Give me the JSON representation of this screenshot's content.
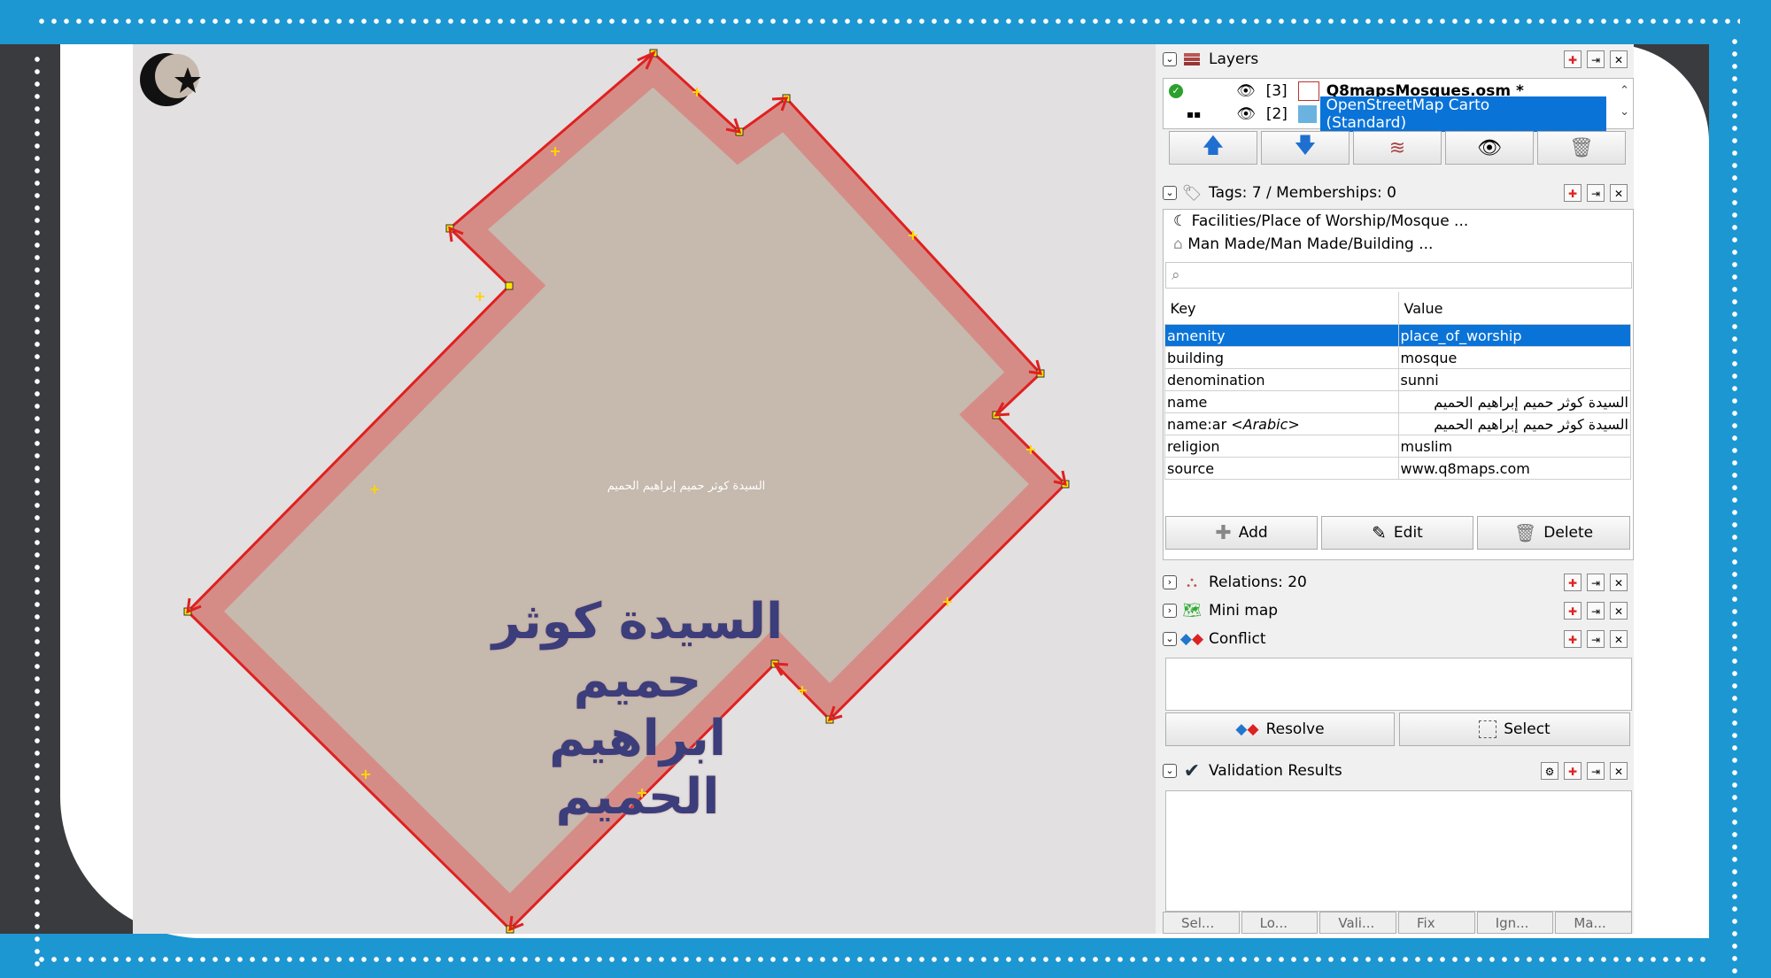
{
  "map": {
    "label_small": "السيدة كوثر حميم إبراهيم الحميم",
    "label_big_lines": [
      "السيدة كوثر",
      "حميم ابراهيم",
      "الحميم"
    ],
    "symbol": "mosque-crescent-star"
  },
  "layers": {
    "title": "Layers",
    "items": [
      {
        "index": "[3]",
        "name": "Q8mapsMosques.osm *",
        "active": true,
        "visible": true
      },
      {
        "index": "[2]",
        "name": "OpenStreetMap Carto (Standard)",
        "selected": true,
        "visible": true
      }
    ],
    "toolbar": [
      "move-up-icon",
      "move-down-icon",
      "activate-layer-icon",
      "toggle-visibility-icon",
      "delete-layer-icon"
    ]
  },
  "tags": {
    "title": "Tags: 7 / Memberships: 0",
    "presets": [
      "Facilities/Place of Worship/Mosque ...",
      "Man Made/Man Made/Building ..."
    ],
    "search_placeholder": "",
    "col_key": "Key",
    "col_value": "Value",
    "rows": [
      {
        "key": "amenity",
        "value": "place_of_worship"
      },
      {
        "key": "building",
        "value": "mosque"
      },
      {
        "key": "denomination",
        "value": "sunni"
      },
      {
        "key": "name",
        "value": "السيدة كوثر حميم إبراهيم الحميم"
      },
      {
        "key": "name:ar",
        "key_hint": "<Arabic>",
        "value": "السيدة كوثر حميم إبراهيم الحميم"
      },
      {
        "key": "religion",
        "value": "muslim"
      },
      {
        "key": "source",
        "value": "www.q8maps.com"
      }
    ],
    "add_label": "Add",
    "edit_label": "Edit",
    "delete_label": "Delete"
  },
  "relations": {
    "title": "Relations: 20"
  },
  "minimap": {
    "title": "Mini map"
  },
  "conflict": {
    "title": "Conflict",
    "resolve_label": "Resolve",
    "select_label": "Select"
  },
  "validation": {
    "title": "Validation Results",
    "tabs": [
      "Sel...",
      "Lo...",
      "Vali...",
      "Fix",
      "Ign...",
      "Ma..."
    ]
  },
  "colors": {
    "frame_blue": "#1d97d2",
    "frame_dark": "#3a3b3e",
    "selection": "#0a73d8",
    "way_red": "#e02020"
  }
}
